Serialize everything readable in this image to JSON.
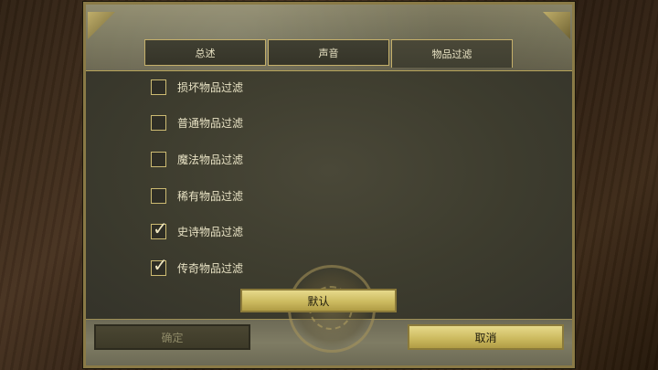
{
  "tabs": [
    {
      "label": "总述",
      "active": false
    },
    {
      "label": "声音",
      "active": false
    },
    {
      "label": "物品过滤",
      "active": true
    }
  ],
  "filters": [
    {
      "label": "损坏物品过滤",
      "checked": false
    },
    {
      "label": "普通物品过滤",
      "checked": false
    },
    {
      "label": "魔法物品过滤",
      "checked": false
    },
    {
      "label": "稀有物品过滤",
      "checked": false
    },
    {
      "label": "史诗物品过滤",
      "checked": true
    },
    {
      "label": "传奇物品过滤",
      "checked": true
    }
  ],
  "buttons": {
    "default_label": "默认",
    "ok_label": "确定",
    "ok_enabled": false,
    "cancel_label": "取消"
  },
  "colors": {
    "accent_gold": "#cdbb60",
    "panel": "#3d3c2e",
    "text": "#e8e2c4",
    "disabled_text": "#8f8a68"
  },
  "icons": {
    "checked": "check-mark-icon"
  }
}
